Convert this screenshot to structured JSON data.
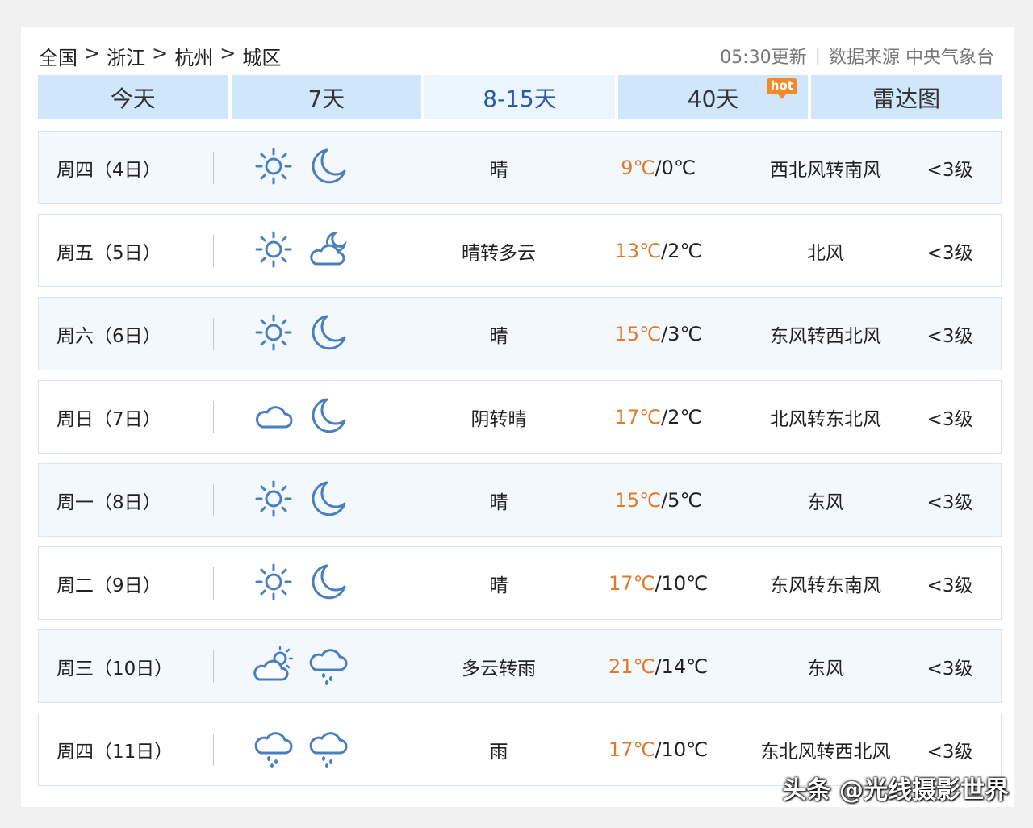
{
  "breadcrumb": {
    "c1": "全国",
    "c2": "浙江",
    "c3": "杭州",
    "c4": "城区",
    "sep": ">"
  },
  "meta": {
    "update": "05:30更新",
    "divider": "|",
    "source": "数据来源 中央气象台"
  },
  "tabs": [
    {
      "label": "今天"
    },
    {
      "label": "7天"
    },
    {
      "label": "8-15天"
    },
    {
      "label": "40天",
      "badge": "hot"
    },
    {
      "label": "雷达图"
    }
  ],
  "active_tab": "8-15天",
  "colors": {
    "tab_bg": "#cfe6fb",
    "tab_active_bg": "#eaf5fe",
    "tab_active_text": "#2b58a8",
    "high_temp": "#e07a2b",
    "hot_badge": "#f28a2a",
    "icon_blue": "#4a7fbf"
  },
  "forecast": [
    {
      "day": "周四（4日）",
      "icon_day": "sun-icon",
      "icon_night": "moon-icon",
      "cond": "晴",
      "hi": "9℃",
      "lo": "0℃",
      "wind": "西北风转南风",
      "level": "<3级"
    },
    {
      "day": "周五（5日）",
      "icon_day": "sun-icon",
      "icon_night": "cloudy-night-icon",
      "cond": "晴转多云",
      "hi": "13℃",
      "lo": "2℃",
      "wind": "北风",
      "level": "<3级"
    },
    {
      "day": "周六（6日）",
      "icon_day": "sun-icon",
      "icon_night": "moon-icon",
      "cond": "晴",
      "hi": "15℃",
      "lo": "3℃",
      "wind": "东风转西北风",
      "level": "<3级"
    },
    {
      "day": "周日（7日）",
      "icon_day": "cloud-icon",
      "icon_night": "moon-icon",
      "cond": "阴转晴",
      "hi": "17℃",
      "lo": "2℃",
      "wind": "北风转东北风",
      "level": "<3级"
    },
    {
      "day": "周一（8日）",
      "icon_day": "sun-icon",
      "icon_night": "moon-icon",
      "cond": "晴",
      "hi": "15℃",
      "lo": "5℃",
      "wind": "东风",
      "level": "<3级"
    },
    {
      "day": "周二（9日）",
      "icon_day": "sun-icon",
      "icon_night": "moon-icon",
      "cond": "晴",
      "hi": "17℃",
      "lo": "10℃",
      "wind": "东风转东南风",
      "level": "<3级"
    },
    {
      "day": "周三（10日）",
      "icon_day": "partly-cloudy-icon",
      "icon_night": "rain-icon",
      "cond": "多云转雨",
      "hi": "21℃",
      "lo": "14℃",
      "wind": "东风",
      "level": "<3级"
    },
    {
      "day": "周四（11日）",
      "icon_day": "rain-icon",
      "icon_night": "rain-icon",
      "cond": "雨",
      "hi": "17℃",
      "lo": "10℃",
      "wind": "东北风转西北风",
      "level": "<3级"
    }
  ],
  "slash": "/",
  "watermark": "头条 @光线摄影世界"
}
